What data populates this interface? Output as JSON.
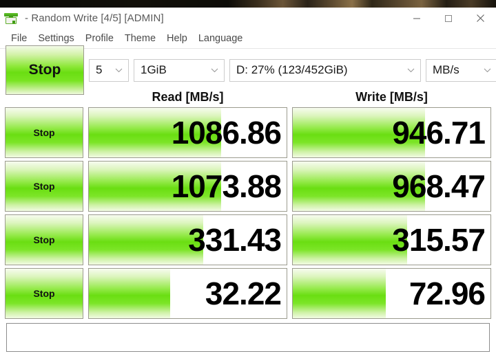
{
  "window": {
    "title": "- Random Write [4/5] [ADMIN]",
    "icon": "crystaldiskmark-icon",
    "controls": {
      "minimize": "minimize-icon",
      "maximize": "maximize-icon",
      "close": "close-icon"
    }
  },
  "menubar": {
    "items": [
      {
        "label": "File"
      },
      {
        "label": "Settings"
      },
      {
        "label": "Profile"
      },
      {
        "label": "Theme"
      },
      {
        "label": "Help"
      },
      {
        "label": "Language"
      }
    ]
  },
  "toolbar": {
    "main_button_label": "Stop",
    "count": "5",
    "size": "1GiB",
    "drive": "D: 27% (123/452GiB)",
    "unit": "MB/s"
  },
  "table": {
    "headers": {
      "read": "Read [MB/s]",
      "write": "Write [MB/s]"
    },
    "rows": [
      {
        "button_label": "Stop",
        "read_value": "1086.86",
        "read_fill_pct": 67,
        "write_value": "946.71",
        "write_fill_pct": 67
      },
      {
        "button_label": "Stop",
        "read_value": "1073.88",
        "read_fill_pct": 67,
        "write_value": "968.47",
        "write_fill_pct": 67
      },
      {
        "button_label": "Stop",
        "read_value": "331.43",
        "read_fill_pct": 58,
        "write_value": "315.57",
        "write_fill_pct": 58
      },
      {
        "button_label": "Stop",
        "read_value": "32.22",
        "read_fill_pct": 41,
        "write_value": "72.96",
        "write_fill_pct": 47
      }
    ]
  },
  "statusbar": {
    "text": ""
  },
  "colors": {
    "accent_green": "#6ade12",
    "button_border": "#9b9b8e",
    "menu_text": "#4a4a4a",
    "title_text": "#5a5a5a"
  }
}
